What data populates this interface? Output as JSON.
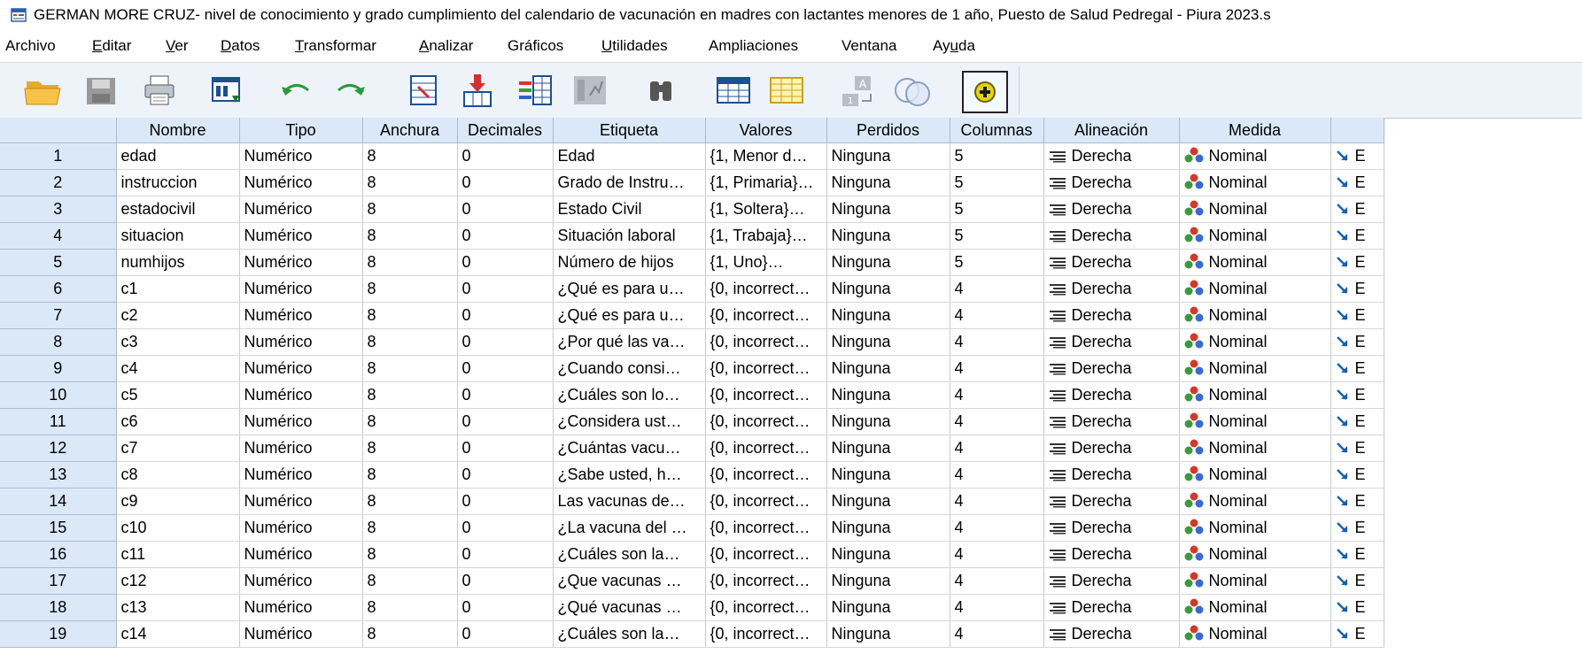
{
  "window": {
    "title": "GERMAN MORE CRUZ- nivel de conocimiento y grado cumplimiento del calendario de vacunación en madres con lactantes menores de 1 año, Puesto de Salud Pedregal - Piura 2023.s"
  },
  "menu": [
    {
      "label": "Archivo",
      "mnemonic_index": -1
    },
    {
      "label": "Editar",
      "mnemonic_index": 0
    },
    {
      "label": "Ver",
      "mnemonic_index": 0
    },
    {
      "label": "Datos",
      "mnemonic_index": 0
    },
    {
      "label": "Transformar",
      "mnemonic_index": 0
    },
    {
      "label": "Analizar",
      "mnemonic_index": 0
    },
    {
      "label": "Gráficos",
      "mnemonic_index": -1
    },
    {
      "label": "Utilidades",
      "mnemonic_index": 0
    },
    {
      "label": "Ampliaciones",
      "mnemonic_index": -1
    },
    {
      "label": "Ventana",
      "mnemonic_index": -1
    },
    {
      "label": "Ayuda",
      "mnemonic_index": 2
    }
  ],
  "toolbar": {
    "buttons": [
      {
        "icon": "open-folder-icon"
      },
      {
        "icon": "save-icon"
      },
      {
        "icon": "print-icon"
      },
      {
        "icon": "dialog-recall-icon"
      },
      {
        "icon": "undo-icon"
      },
      {
        "icon": "redo-icon"
      },
      {
        "icon": "goto-case-icon"
      },
      {
        "icon": "goto-variable-icon"
      },
      {
        "icon": "variables-icon"
      },
      {
        "icon": "run-descriptives-icon"
      },
      {
        "icon": "find-icon"
      },
      {
        "icon": "insert-cases-icon"
      },
      {
        "icon": "insert-variable-icon"
      },
      {
        "icon": "value-labels-icon"
      },
      {
        "icon": "use-sets-icon"
      },
      {
        "icon": "add-on-icon"
      }
    ]
  },
  "grid": {
    "columns": [
      "",
      "Nombre",
      "Tipo",
      "Anchura",
      "Decimales",
      "Etiqueta",
      "Valores",
      "Perdidos",
      "Columnas",
      "Alineación",
      "Medida",
      ""
    ],
    "rows": [
      {
        "n": "1",
        "nombre": "edad",
        "tipo": "Numérico",
        "anchura": "8",
        "decimales": "0",
        "etiqueta": "Edad",
        "valores": "{1, Menor d…",
        "perdidos": "Ninguna",
        "columnas": "5",
        "alineacion": "Derecha",
        "medida": "Nominal",
        "rol": "E"
      },
      {
        "n": "2",
        "nombre": "instruccion",
        "tipo": "Numérico",
        "anchura": "8",
        "decimales": "0",
        "etiqueta": "Grado de Instru…",
        "valores": "{1, Primaria}…",
        "perdidos": "Ninguna",
        "columnas": "5",
        "alineacion": "Derecha",
        "medida": "Nominal",
        "rol": "E"
      },
      {
        "n": "3",
        "nombre": "estadocivil",
        "tipo": "Numérico",
        "anchura": "8",
        "decimales": "0",
        "etiqueta": "Estado Civil",
        "valores": "{1, Soltera}…",
        "perdidos": "Ninguna",
        "columnas": "5",
        "alineacion": "Derecha",
        "medida": "Nominal",
        "rol": "E"
      },
      {
        "n": "4",
        "nombre": "situacion",
        "tipo": "Numérico",
        "anchura": "8",
        "decimales": "0",
        "etiqueta": "Situación laboral",
        "valores": "{1, Trabaja}…",
        "perdidos": "Ninguna",
        "columnas": "5",
        "alineacion": "Derecha",
        "medida": "Nominal",
        "rol": "E"
      },
      {
        "n": "5",
        "nombre": "numhijos",
        "tipo": "Numérico",
        "anchura": "8",
        "decimales": "0",
        "etiqueta": "Número de hijos",
        "valores": "{1, Uno}…",
        "perdidos": "Ninguna",
        "columnas": "5",
        "alineacion": "Derecha",
        "medida": "Nominal",
        "rol": "E"
      },
      {
        "n": "6",
        "nombre": "c1",
        "tipo": "Numérico",
        "anchura": "8",
        "decimales": "0",
        "etiqueta": "¿Qué es para u…",
        "valores": "{0, incorrect…",
        "perdidos": "Ninguna",
        "columnas": "4",
        "alineacion": "Derecha",
        "medida": "Nominal",
        "rol": "E"
      },
      {
        "n": "7",
        "nombre": "c2",
        "tipo": "Numérico",
        "anchura": "8",
        "decimales": "0",
        "etiqueta": "¿Qué es para u…",
        "valores": "{0, incorrect…",
        "perdidos": "Ninguna",
        "columnas": "4",
        "alineacion": "Derecha",
        "medida": "Nominal",
        "rol": "E"
      },
      {
        "n": "8",
        "nombre": "c3",
        "tipo": "Numérico",
        "anchura": "8",
        "decimales": "0",
        "etiqueta": "¿Por qué las va…",
        "valores": "{0, incorrect…",
        "perdidos": "Ninguna",
        "columnas": "4",
        "alineacion": "Derecha",
        "medida": "Nominal",
        "rol": "E"
      },
      {
        "n": "9",
        "nombre": "c4",
        "tipo": "Numérico",
        "anchura": "8",
        "decimales": "0",
        "etiqueta": "¿Cuando consi…",
        "valores": "{0, incorrect…",
        "perdidos": "Ninguna",
        "columnas": "4",
        "alineacion": "Derecha",
        "medida": "Nominal",
        "rol": "E"
      },
      {
        "n": "10",
        "nombre": "c5",
        "tipo": "Numérico",
        "anchura": "8",
        "decimales": "0",
        "etiqueta": "¿Cuáles son lo…",
        "valores": "{0, incorrect…",
        "perdidos": "Ninguna",
        "columnas": "4",
        "alineacion": "Derecha",
        "medida": "Nominal",
        "rol": "E"
      },
      {
        "n": "11",
        "nombre": "c6",
        "tipo": "Numérico",
        "anchura": "8",
        "decimales": "0",
        "etiqueta": "¿Considera ust…",
        "valores": "{0, incorrect…",
        "perdidos": "Ninguna",
        "columnas": "4",
        "alineacion": "Derecha",
        "medida": "Nominal",
        "rol": "E"
      },
      {
        "n": "12",
        "nombre": "c7",
        "tipo": "Numérico",
        "anchura": "8",
        "decimales": "0",
        "etiqueta": "¿Cuántas vacu…",
        "valores": "{0, incorrect…",
        "perdidos": "Ninguna",
        "columnas": "4",
        "alineacion": "Derecha",
        "medida": "Nominal",
        "rol": "E"
      },
      {
        "n": "13",
        "nombre": "c8",
        "tipo": "Numérico",
        "anchura": "8",
        "decimales": "0",
        "etiqueta": "¿Sabe usted, h…",
        "valores": "{0, incorrect…",
        "perdidos": "Ninguna",
        "columnas": "4",
        "alineacion": "Derecha",
        "medida": "Nominal",
        "rol": "E"
      },
      {
        "n": "14",
        "nombre": "c9",
        "tipo": "Numérico",
        "anchura": "8",
        "decimales": "0",
        "etiqueta": "Las vacunas de…",
        "valores": "{0, incorrect…",
        "perdidos": "Ninguna",
        "columnas": "4",
        "alineacion": "Derecha",
        "medida": "Nominal",
        "rol": "E"
      },
      {
        "n": "15",
        "nombre": "c10",
        "tipo": "Numérico",
        "anchura": "8",
        "decimales": "0",
        "etiqueta": "¿La vacuna del …",
        "valores": "{0, incorrect…",
        "perdidos": "Ninguna",
        "columnas": "4",
        "alineacion": "Derecha",
        "medida": "Nominal",
        "rol": "E"
      },
      {
        "n": "16",
        "nombre": "c11",
        "tipo": "Numérico",
        "anchura": "8",
        "decimales": "0",
        "etiqueta": "¿Cuáles son la…",
        "valores": "{0, incorrect…",
        "perdidos": "Ninguna",
        "columnas": "4",
        "alineacion": "Derecha",
        "medida": "Nominal",
        "rol": "E"
      },
      {
        "n": "17",
        "nombre": "c12",
        "tipo": "Numérico",
        "anchura": "8",
        "decimales": "0",
        "etiqueta": "¿Que vacunas …",
        "valores": "{0, incorrect…",
        "perdidos": "Ninguna",
        "columnas": "4",
        "alineacion": "Derecha",
        "medida": "Nominal",
        "rol": "E"
      },
      {
        "n": "18",
        "nombre": "c13",
        "tipo": "Numérico",
        "anchura": "8",
        "decimales": "0",
        "etiqueta": "¿Qué vacunas …",
        "valores": "{0, incorrect…",
        "perdidos": "Ninguna",
        "columnas": "4",
        "alineacion": "Derecha",
        "medida": "Nominal",
        "rol": "E"
      },
      {
        "n": "19",
        "nombre": "c14",
        "tipo": "Numérico",
        "anchura": "8",
        "decimales": "0",
        "etiqueta": "¿Cuáles son la…",
        "valores": "{0, incorrect…",
        "perdidos": "Ninguna",
        "columnas": "4",
        "alineacion": "Derecha",
        "medida": "Nominal",
        "rol": "E"
      }
    ]
  },
  "colors": {
    "header_bg": "#dbe8f8",
    "toolbar_bg": "#eef3fa",
    "grid_line": "#c9c9c9"
  }
}
